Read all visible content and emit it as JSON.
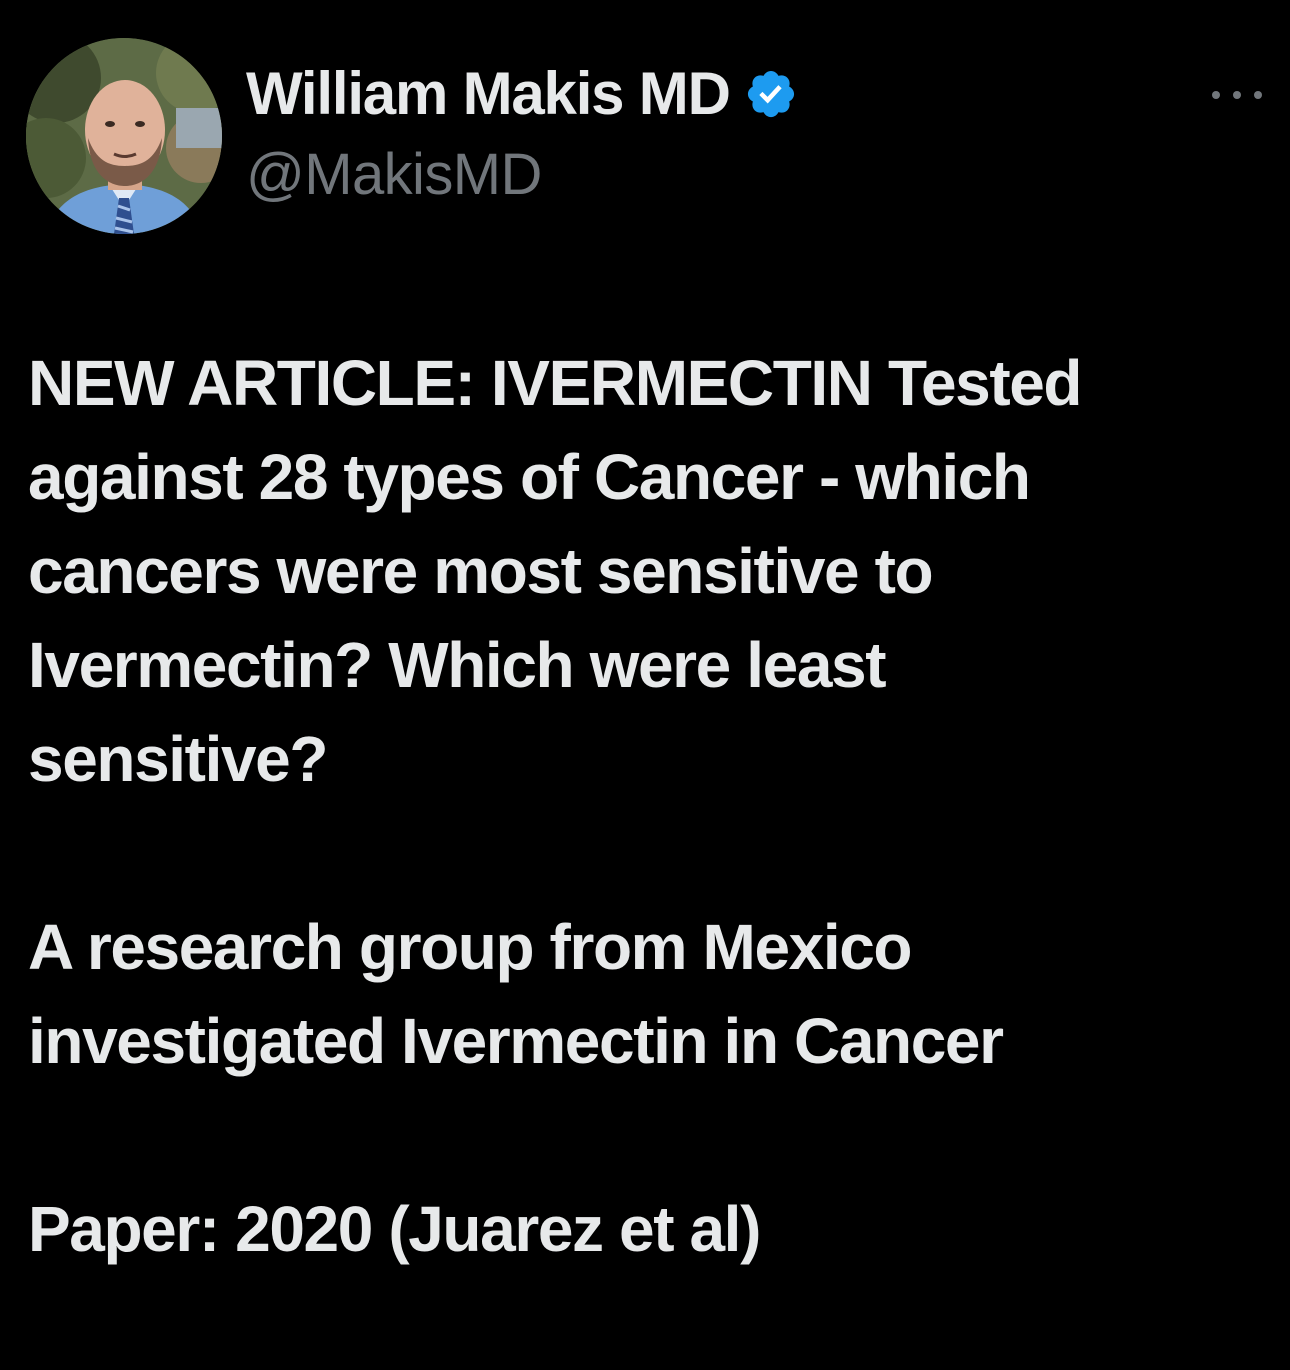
{
  "author": {
    "display_name": "William Makis MD",
    "handle": "@MakisMD",
    "verified_icon": "verified-badge-icon",
    "avatar": "profile-photo"
  },
  "more_menu": {
    "icon": "more-horizontal-icon"
  },
  "colors": {
    "background": "#000000",
    "primary_text": "#e7e9ea",
    "secondary_text": "#71767b",
    "verified_blue": "#1d9bf0"
  },
  "tweet": {
    "paragraphs": [
      "NEW ARTICLE: IVERMECTIN Tested\nagainst 28 types of Cancer - which\ncancers were most sensitive to\nIvermectin? Which were least\nsensitive?",
      "A research group from Mexico\ninvestigated Ivermectin in Cancer",
      "Paper: 2020 (Juarez et al)"
    ]
  }
}
